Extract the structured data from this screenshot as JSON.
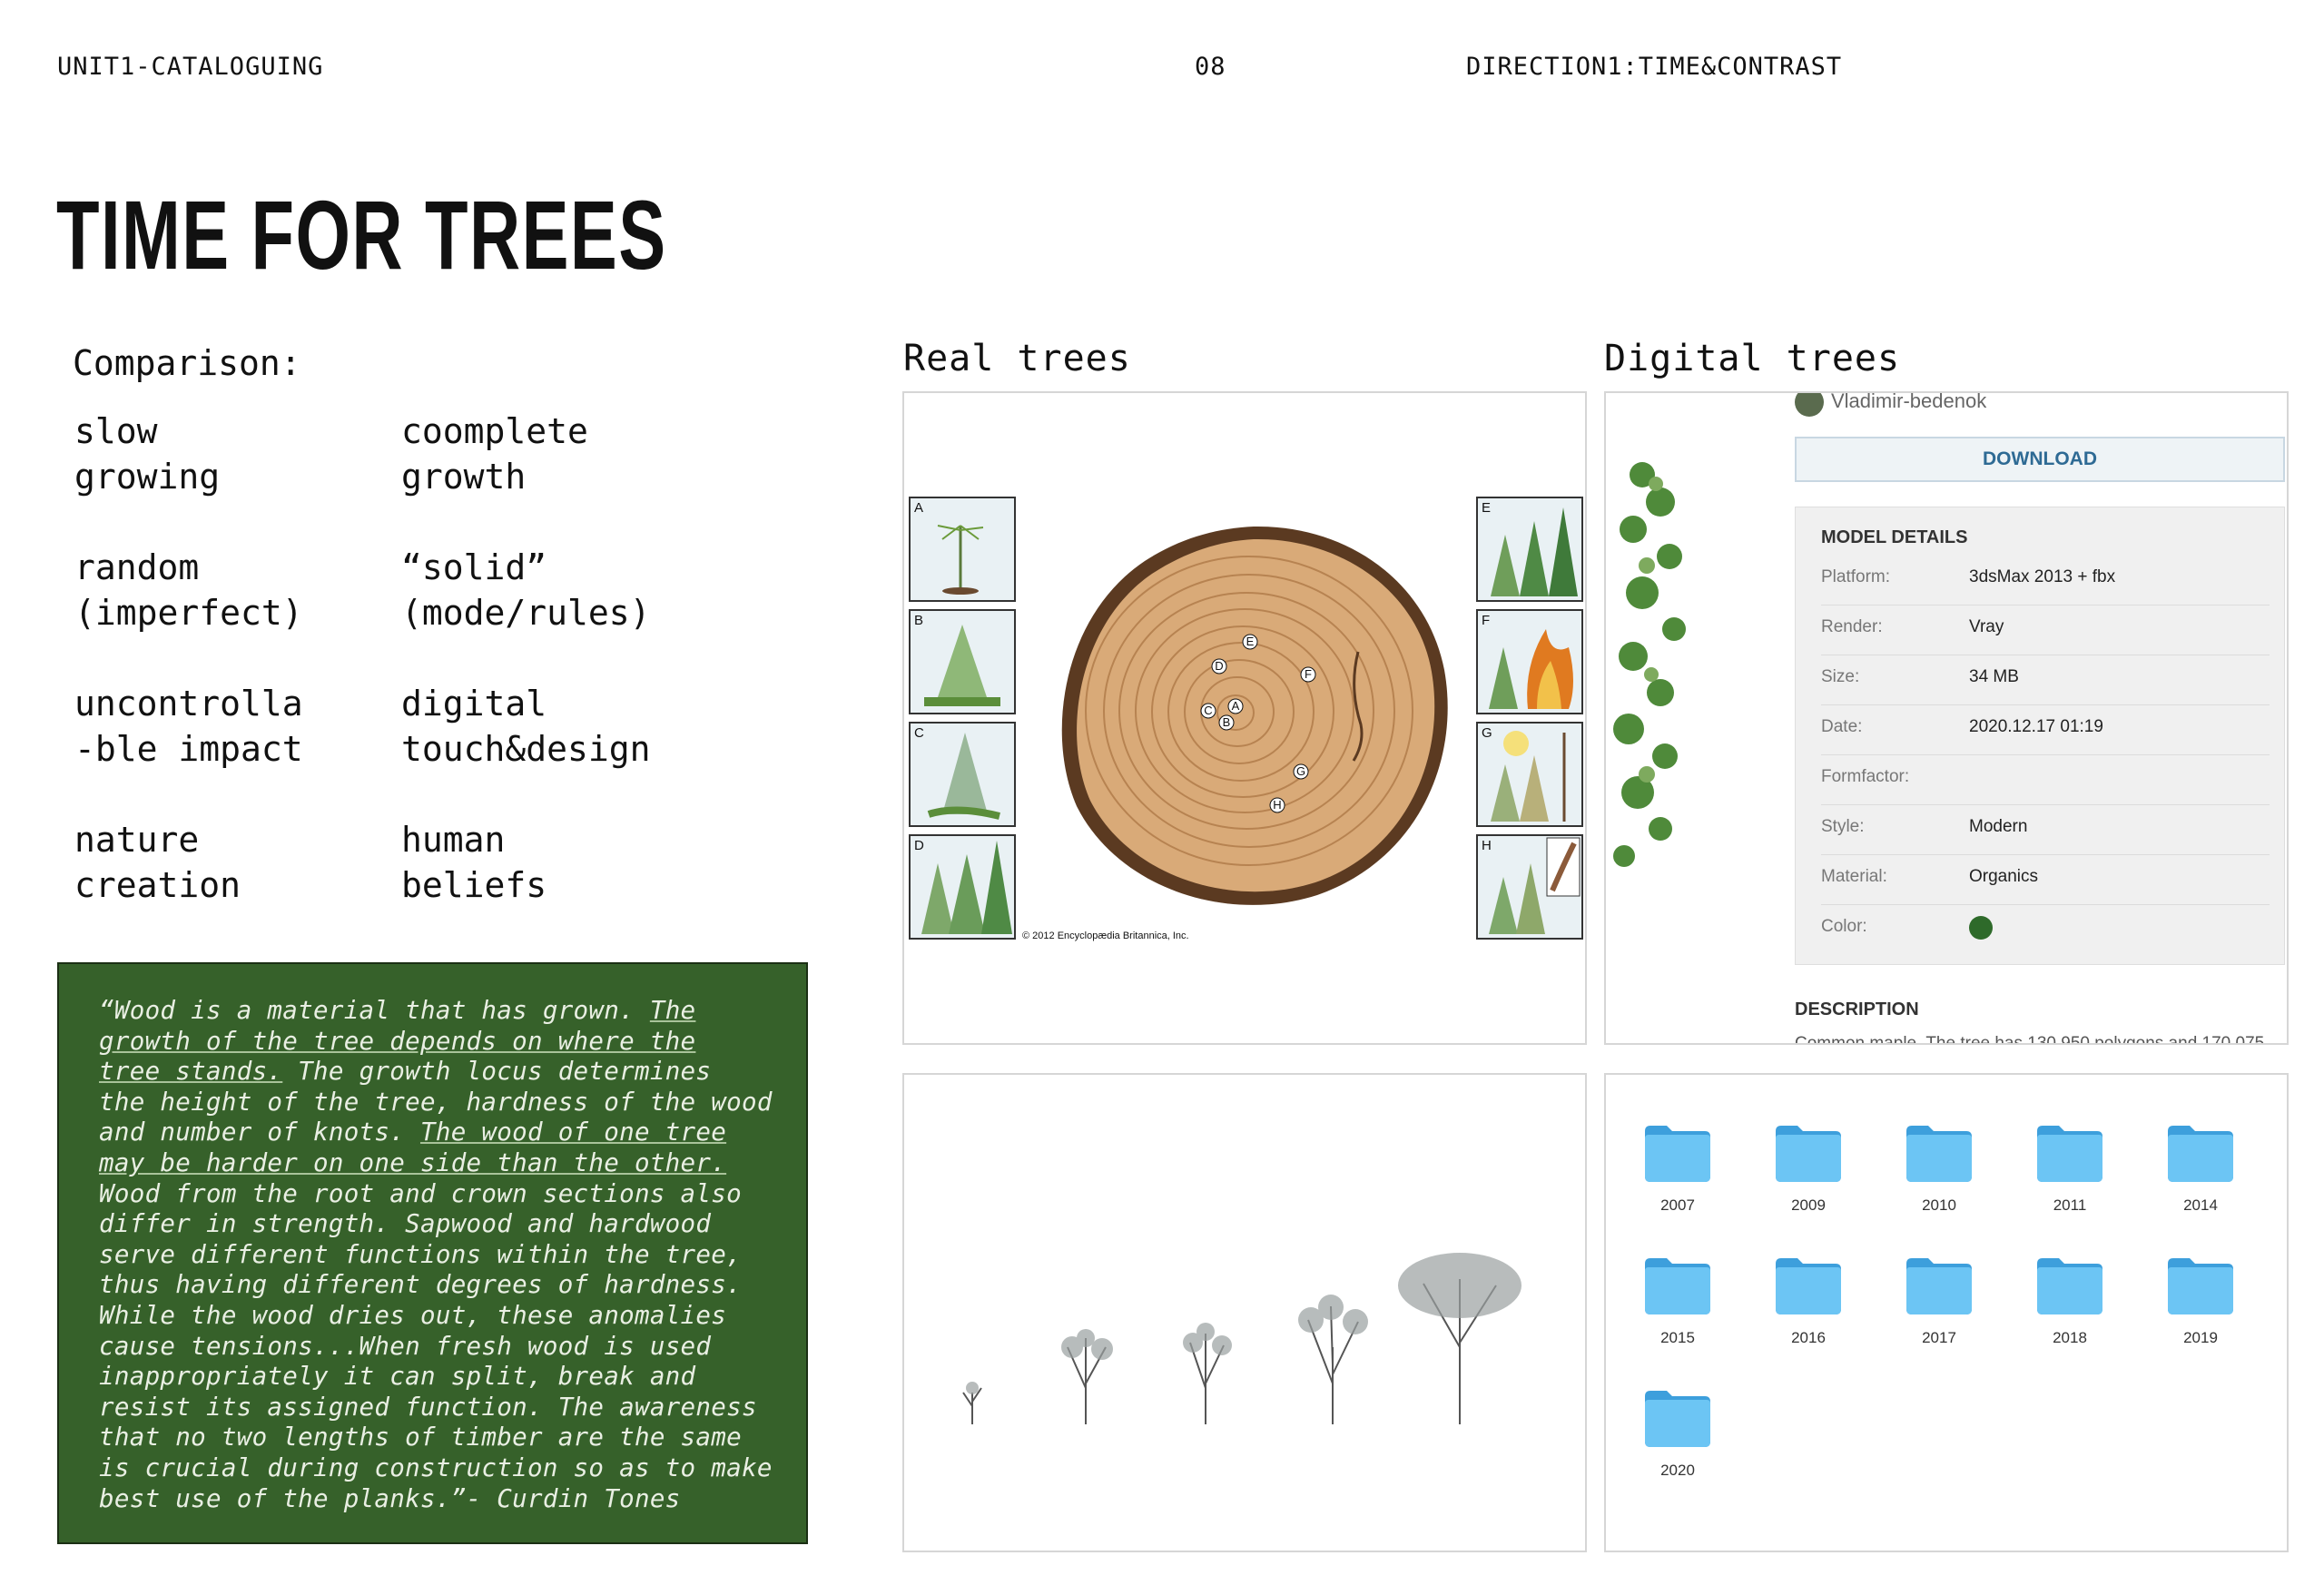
{
  "header": {
    "unit": "UNIT1-CATALOGUING",
    "page_number": "08",
    "direction": "DIRECTION1:TIME&CONTRAST"
  },
  "title": "TIME FOR TREES",
  "comparison": {
    "heading": "Comparison:",
    "left": [
      "slow\ngrowing",
      "random\n(imperfect)",
      "uncontrolla\n-ble impact",
      "nature\ncreation"
    ],
    "right": [
      "coomplete\ngrowth",
      "“solid”\n(mode/rules)",
      "digital\ntouch&design",
      "human\nbeliefs"
    ]
  },
  "quote": {
    "p1": "“Wood is a material that has grown. ",
    "u1": "The\ngrowth of the tree depends on where the\ntree stands.",
    "p2": " The growth locus determines\nthe height of the tree, hardness of the wood\nand number of knots. ",
    "u2": "The wood of one tree\nmay be harder on one side than the other.",
    "p3": "\nWood from the root and crown sections also\ndiffer in strength. Sapwood and hardwood\nserve different functions within the tree,\nthus having different degrees of hardness.\nWhile the wood dries out, these anomalies\ncause tensions...When fresh wood is used\ninappropriately it can split, break and\nresist its assigned function. The awareness\nthat no two lengths of timber are the same\nis crucial during construction so as to make\nbest use of the planks.”- Curdin Tones"
  },
  "real_trees": {
    "label": "Real trees",
    "thumb_letters": [
      "A",
      "B",
      "C",
      "D",
      "E",
      "F",
      "G",
      "H"
    ],
    "ring_markers": [
      "A",
      "B",
      "C",
      "D",
      "E",
      "F",
      "G",
      "H"
    ],
    "copyright": "© 2012 Encyclopædia Britannica, Inc."
  },
  "digital_trees": {
    "label": "Digital trees",
    "user": "Vladimir-bedenok",
    "download_label": "DOWNLOAD",
    "details_title": "MODEL DETAILS",
    "details": [
      {
        "key": "Platform:",
        "value": "3dsMax 2013 + fbx"
      },
      {
        "key": "Render:",
        "value": "Vray"
      },
      {
        "key": "Size:",
        "value": "34 MB"
      },
      {
        "key": "Date:",
        "value": "2020.12.17 01:19"
      },
      {
        "key": "Formfactor:",
        "value": ""
      },
      {
        "key": "Style:",
        "value": "Modern"
      },
      {
        "key": "Material:",
        "value": "Organics"
      },
      {
        "key": "Color:",
        "value": ""
      }
    ],
    "color_swatch": "#2e6a2a",
    "description_title": "DESCRIPTION",
    "description_text": "Common maple. The tree has 130 950 polygons and 170 075"
  },
  "folders": [
    "2007",
    "2009",
    "2010",
    "2011",
    "2014",
    "2015",
    "2016",
    "2017",
    "2018",
    "2019",
    "2020"
  ],
  "colors": {
    "quote_bg": "#36612a",
    "folder": "#5db8ec",
    "accent_blue": "#2e6a94"
  }
}
